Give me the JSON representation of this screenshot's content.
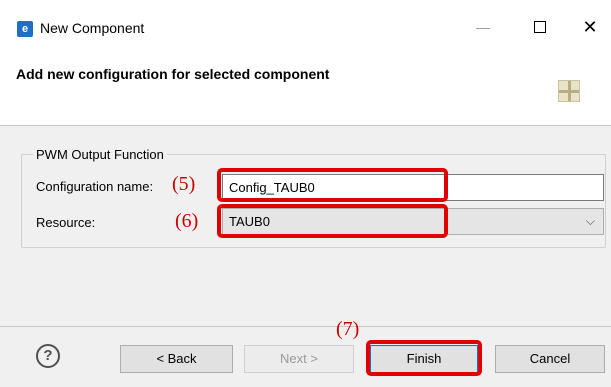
{
  "window": {
    "title": "New Component",
    "app_icon": "renesas-app-icon",
    "minimize_glyph": "—",
    "close_glyph": "✕"
  },
  "banner": {
    "title": "Add new configuration for selected component",
    "icon": "component-wizard-icon"
  },
  "group": {
    "legend": "PWM Output Function"
  },
  "config_name": {
    "label": "Configuration name:",
    "value": "Config_TAUB0",
    "marker": "(5)"
  },
  "resource": {
    "label": "Resource:",
    "selected": "TAUB0",
    "marker": "(6)"
  },
  "footer": {
    "help_glyph": "?",
    "back_label": "< Back",
    "next_label": "Next >",
    "finish_label": "Finish",
    "cancel_label": "Cancel",
    "finish_marker": "(7)"
  },
  "colors": {
    "highlight": "#e00000",
    "marker": "#cc0000",
    "dialog_bg": "#f0f0f0"
  }
}
